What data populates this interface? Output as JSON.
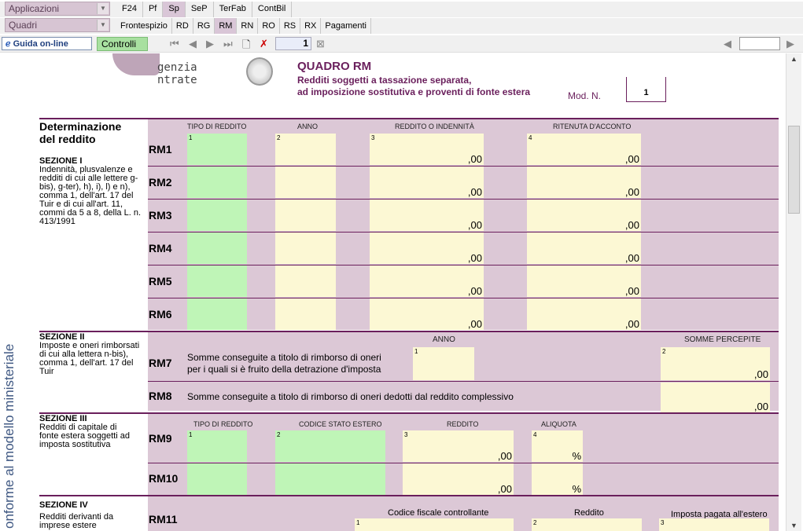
{
  "toolbar": {
    "dd1": "Applicazioni",
    "dd2": "Quadri",
    "tabs1": [
      "F24",
      "Pf",
      "Sp",
      "SeP",
      "TerFab",
      "ContBil"
    ],
    "tabs1_active": "Sp",
    "tabs2": [
      "Frontespizio",
      "RD",
      "RG",
      "RM",
      "RN",
      "RO",
      "RS",
      "RX",
      "Pagamenti"
    ],
    "tabs2_active": "RM",
    "guida": "Guida on-line",
    "controlli": "Controlli",
    "page": "1"
  },
  "header": {
    "logo1": "genzia",
    "logo2": "ntrate",
    "title": "QUADRO RM",
    "subtitle1": "Redditi soggetti a tassazione separata,",
    "subtitle2": "ad imposizione sostitutiva e proventi di fonte estera",
    "modn": "Mod. N.",
    "modval": "1"
  },
  "side_label": "onforme al modello ministeriale",
  "sec0": {
    "title1": "Determinazione",
    "title2": "del reddito",
    "cols": [
      "TIPO DI REDDITO",
      "ANNO",
      "REDDITO O INDENNITÀ",
      "RITENUTA D'ACCONTO"
    ],
    "rows": [
      "RM1",
      "RM2",
      "RM3",
      "RM4",
      "RM5",
      "RM6"
    ],
    "cents": ",00"
  },
  "sec1": {
    "title": "SEZIONE I",
    "body": "Indennità, plusvalenze e redditi di cui alle lettere g-bis), g-ter), h), i), l) e n), comma 1, dell'art. 17 del Tuir e di cui all'art. 11, commi da 5 a 8, della L. n. 413/1991"
  },
  "sec2": {
    "title": "SEZIONE II",
    "body": "Imposte e oneri rimborsati di cui alla lettera n-bis), comma 1, dell'art. 17 del Tuir",
    "anno": "ANNO",
    "somme": "SOMME PERCEPITE",
    "rm7": "RM7",
    "rm7_desc1": "Somme conseguite a titolo di rimborso di oneri",
    "rm7_desc2": "per i quali si è fruito della detrazione d'imposta",
    "rm8": "RM8",
    "rm8_desc": "Somme conseguite a titolo di rimborso di oneri dedotti dal reddito complessivo"
  },
  "sec3": {
    "title": "SEZIONE III",
    "body": "Redditi di capitale di fonte estera soggetti ad imposta sostitutiva",
    "cols": [
      "TIPO DI REDDITO",
      "CODICE STATO ESTERO",
      "REDDITO",
      "ALIQUOTA"
    ],
    "rm9": "RM9",
    "rm10": "RM10",
    "percent": "%"
  },
  "sec4": {
    "title": "SEZIONE IV",
    "body": "Redditi derivanti da imprese estere",
    "rm11": "RM11",
    "col1": "Codice fiscale controllante",
    "col2": "Reddito",
    "col3": "Imposta pagata all'estero"
  }
}
